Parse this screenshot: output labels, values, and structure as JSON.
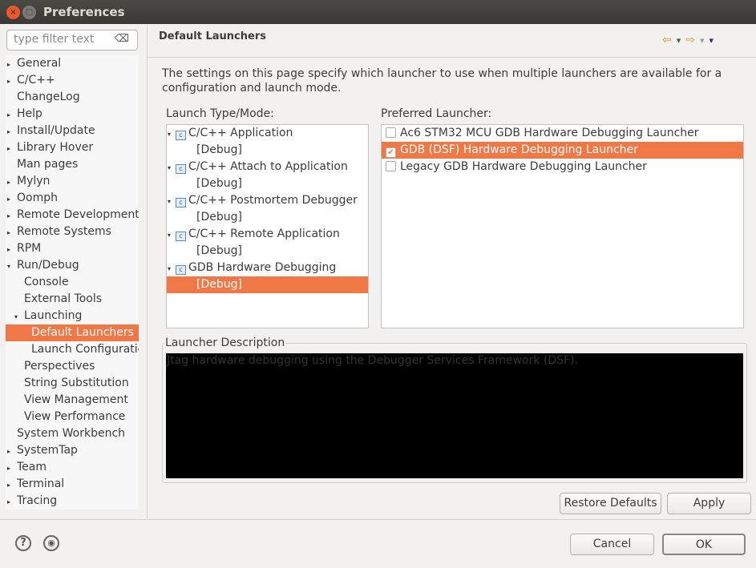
{
  "window": {
    "title": "Preferences",
    "close": "×",
    "maximize": "□"
  },
  "filter": {
    "placeholder": "type filter text",
    "clear": "⌫"
  },
  "tree": [
    {
      "label": "General",
      "indent": 0,
      "arrow": "▸"
    },
    {
      "label": "C/C++",
      "indent": 0,
      "arrow": "▸"
    },
    {
      "label": "ChangeLog",
      "indent": 0,
      "arrow": ""
    },
    {
      "label": "Help",
      "indent": 0,
      "arrow": "▸"
    },
    {
      "label": "Install/Update",
      "indent": 0,
      "arrow": "▸"
    },
    {
      "label": "Library Hover",
      "indent": 0,
      "arrow": "▸"
    },
    {
      "label": "Man pages",
      "indent": 0,
      "arrow": ""
    },
    {
      "label": "Mylyn",
      "indent": 0,
      "arrow": "▸"
    },
    {
      "label": "Oomph",
      "indent": 0,
      "arrow": "▸"
    },
    {
      "label": "Remote Development",
      "indent": 0,
      "arrow": "▸"
    },
    {
      "label": "Remote Systems",
      "indent": 0,
      "arrow": "▸"
    },
    {
      "label": "RPM",
      "indent": 0,
      "arrow": "▸"
    },
    {
      "label": "Run/Debug",
      "indent": 0,
      "arrow": "▾"
    },
    {
      "label": "Console",
      "indent": 1,
      "arrow": ""
    },
    {
      "label": "External Tools",
      "indent": 1,
      "arrow": ""
    },
    {
      "label": "Launching",
      "indent": 1,
      "arrow": "▾"
    },
    {
      "label": "Default Launchers",
      "indent": 2,
      "arrow": "",
      "selected": true
    },
    {
      "label": "Launch Configurations",
      "indent": 2,
      "arrow": ""
    },
    {
      "label": "Perspectives",
      "indent": 1,
      "arrow": ""
    },
    {
      "label": "String Substitution",
      "indent": 1,
      "arrow": ""
    },
    {
      "label": "View Management",
      "indent": 1,
      "arrow": ""
    },
    {
      "label": "View Performance",
      "indent": 1,
      "arrow": ""
    },
    {
      "label": "System Workbench",
      "indent": 0,
      "arrow": ""
    },
    {
      "label": "SystemTap",
      "indent": 0,
      "arrow": "▸"
    },
    {
      "label": "Team",
      "indent": 0,
      "arrow": "▸"
    },
    {
      "label": "Terminal",
      "indent": 0,
      "arrow": "▸"
    },
    {
      "label": "Tracing",
      "indent": 0,
      "arrow": "▸"
    }
  ],
  "page": {
    "title": "Default Launchers",
    "description": "The settings on this page specify which launcher to use when multiple launchers are available for a configuration and launch mode.",
    "nav": {
      "back": "⇦",
      "back_menu": "▾",
      "forward": "⇨",
      "forward_menu": "▾",
      "view_menu": "▾"
    }
  },
  "launch_types": {
    "label": "Launch Type/Mode:",
    "items": [
      {
        "type": "C/C++ Application",
        "mode": "[Debug]"
      },
      {
        "type": "C/C++ Attach to Application",
        "mode": "[Debug]"
      },
      {
        "type": "C/C++ Postmortem Debugger",
        "mode": "[Debug]"
      },
      {
        "type": "C/C++ Remote Application",
        "mode": "[Debug]"
      },
      {
        "type": "GDB Hardware Debugging",
        "mode": "[Debug]",
        "selected": true
      }
    ]
  },
  "preferred": {
    "label": "Preferred Launcher:",
    "items": [
      {
        "label": "Ac6 STM32 MCU GDB Hardware Debugging Launcher",
        "checked": false
      },
      {
        "label": "GDB (DSF) Hardware Debugging Launcher",
        "checked": true
      },
      {
        "label": "Legacy GDB Hardware Debugging Launcher",
        "checked": false
      }
    ]
  },
  "launcher_description": {
    "label": "Launcher Description",
    "text": "Jtag hardware debugging using the Debugger Services Framework (DSF)."
  },
  "buttons": {
    "restore": "Restore Defaults",
    "apply": "Apply",
    "cancel": "Cancel",
    "ok": "OK",
    "help": "?",
    "prefs": "◉"
  }
}
